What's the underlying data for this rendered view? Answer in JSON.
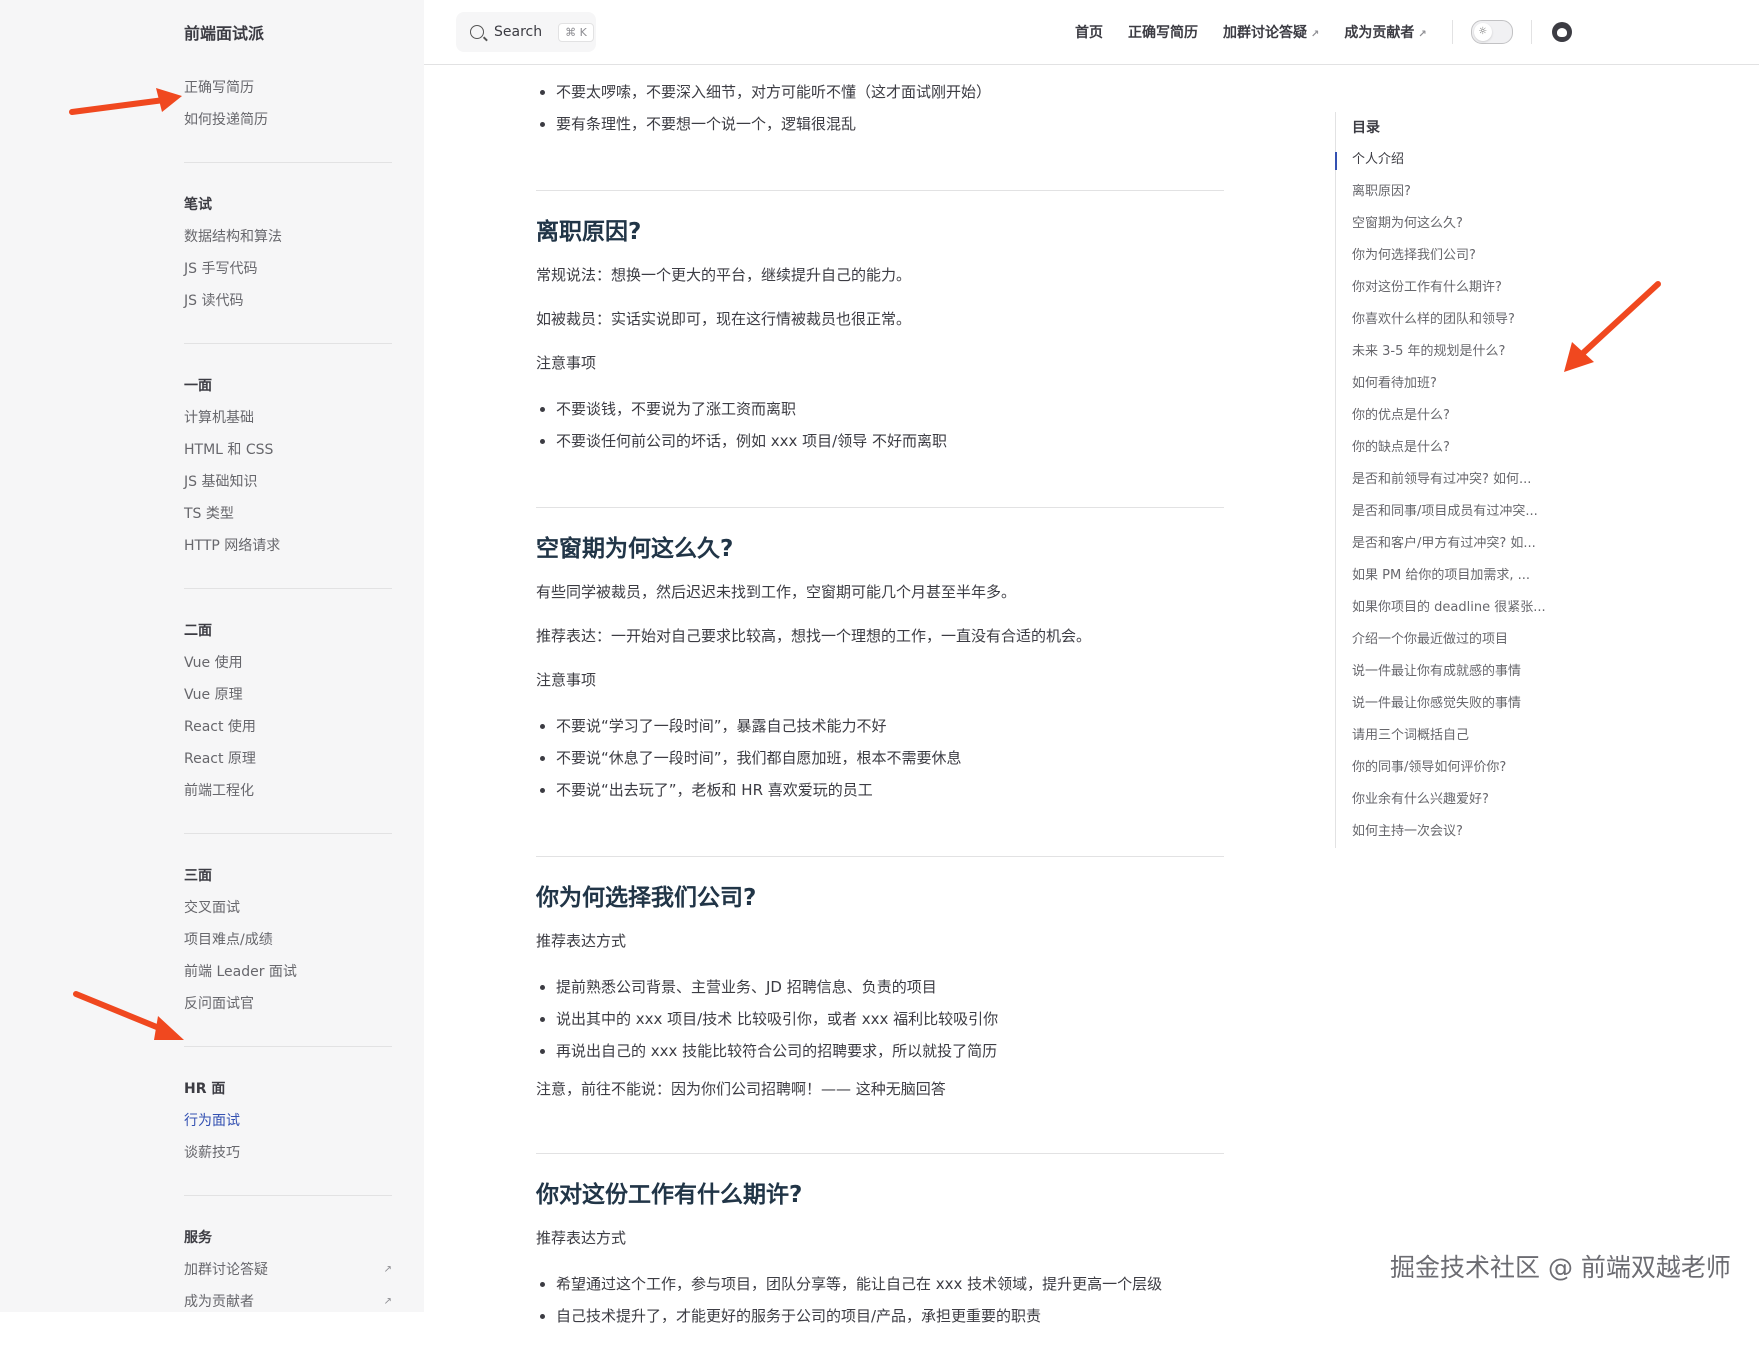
{
  "sidebar": {
    "brand": "前端面试派",
    "groups": [
      {
        "title": "",
        "items": [
          {
            "label": "正确写简历"
          },
          {
            "label": "如何投递简历"
          }
        ]
      },
      {
        "title": "笔试",
        "items": [
          {
            "label": "数据结构和算法"
          },
          {
            "label": "JS 手写代码"
          },
          {
            "label": "JS 读代码"
          }
        ]
      },
      {
        "title": "一面",
        "items": [
          {
            "label": "计算机基础"
          },
          {
            "label": "HTML 和 CSS"
          },
          {
            "label": "JS 基础知识"
          },
          {
            "label": "TS 类型"
          },
          {
            "label": "HTTP 网络请求"
          }
        ]
      },
      {
        "title": "二面",
        "items": [
          {
            "label": "Vue 使用"
          },
          {
            "label": "Vue 原理"
          },
          {
            "label": "React 使用"
          },
          {
            "label": "React 原理"
          },
          {
            "label": "前端工程化"
          }
        ]
      },
      {
        "title": "三面",
        "items": [
          {
            "label": "交叉面试"
          },
          {
            "label": "项目难点/成绩"
          },
          {
            "label": "前端 Leader 面试"
          },
          {
            "label": "反问面试官"
          }
        ]
      },
      {
        "title": "HR 面",
        "items": [
          {
            "label": "行为面试"
          },
          {
            "label": "谈薪技巧"
          }
        ]
      },
      {
        "title": "服务",
        "items": [
          {
            "label": "加群讨论答疑"
          },
          {
            "label": "成为贡献者"
          }
        ]
      }
    ]
  },
  "topnav": {
    "search_label": "Search",
    "search_kbd": "⌘ K",
    "links": [
      "首页",
      "正确写简历",
      "加群讨论答疑",
      "成为贡献者"
    ]
  },
  "content": {
    "intro_bullets": [
      "不要太啰嗦，不要深入细节，对方可能听不懂（这才面试刚开始）",
      "要有条理性，不要想一个说一个，逻辑很混乱"
    ],
    "sections": [
      {
        "heading": "离职原因?",
        "paras": [
          "常规说法：想换一个更大的平台，继续提升自己的能力。",
          "如被裁员：实话实说即可，现在这行情被裁员也很正常。",
          "注意事项"
        ],
        "bullets": [
          "不要谈钱，不要说为了涨工资而离职",
          "不要谈任何前公司的坏话，例如 xxx 项目/领导 不好而离职"
        ],
        "after": ""
      },
      {
        "heading": "空窗期为何这么久?",
        "paras": [
          "有些同学被裁员，然后迟迟未找到工作，空窗期可能几个月甚至半年多。",
          "推荐表达：一开始对自己要求比较高，想找一个理想的工作，一直没有合适的机会。",
          "注意事项"
        ],
        "bullets": [
          "不要说“学习了一段时间”，暴露自己技术能力不好",
          "不要说“休息了一段时间”，我们都自愿加班，根本不需要休息",
          "不要说“出去玩了”，老板和 HR 喜欢爱玩的员工"
        ],
        "after": ""
      },
      {
        "heading": "你为何选择我们公司?",
        "paras": [
          "推荐表达方式"
        ],
        "bullets": [
          "提前熟悉公司背景、主营业务、JD 招聘信息、负责的项目",
          "说出其中的 xxx 项目/技术 比较吸引你，或者 xxx 福利比较吸引你",
          "再说出自己的 xxx 技能比较符合公司的招聘要求，所以就投了简历"
        ],
        "after": "注意，前往不能说：因为你们公司招聘啊！—— 这种无脑回答"
      },
      {
        "heading": "你对这份工作有什么期许?",
        "paras": [
          "推荐表达方式"
        ],
        "bullets": [
          "希望通过这个工作，参与项目，团队分享等，能让自己在 xxx 技术领域，提升更高一个层级",
          "自己技术提升了，才能更好的服务于公司的项目/产品，承担更重要的职责"
        ],
        "after": ""
      }
    ]
  },
  "outline": {
    "title": "目录",
    "items": [
      "个人介绍",
      "离职原因?",
      "空窗期为何这么久?",
      "你为何选择我们公司?",
      "你对这份工作有什么期许?",
      "你喜欢什么样的团队和领导?",
      "未来 3-5 年的规划是什么?",
      "如何看待加班?",
      "你的优点是什么?",
      "你的缺点是什么?",
      "是否和前领导有过冲突? 如何...",
      "是否和同事/项目成员有过冲突...",
      "是否和客户/甲方有过冲突? 如...",
      "如果 PM 给你的项目加需求, ...",
      "如果你项目的 deadline 很紧张...",
      "介绍一个你最近做过的项目",
      "说一件最让你有成就感的事情",
      "说一件最让你感觉失败的事情",
      "请用三个词概括自己",
      "你的同事/领导如何评价你?",
      "你业余有什么兴趣爱好?",
      "如何主持一次会议?"
    ]
  },
  "watermark": "掘金技术社区 @ 前端双越老师",
  "colors": {
    "accent": "#3451b2",
    "annotation_arrow": "#f0481f",
    "sidebar_bg": "#f6f6f7"
  }
}
